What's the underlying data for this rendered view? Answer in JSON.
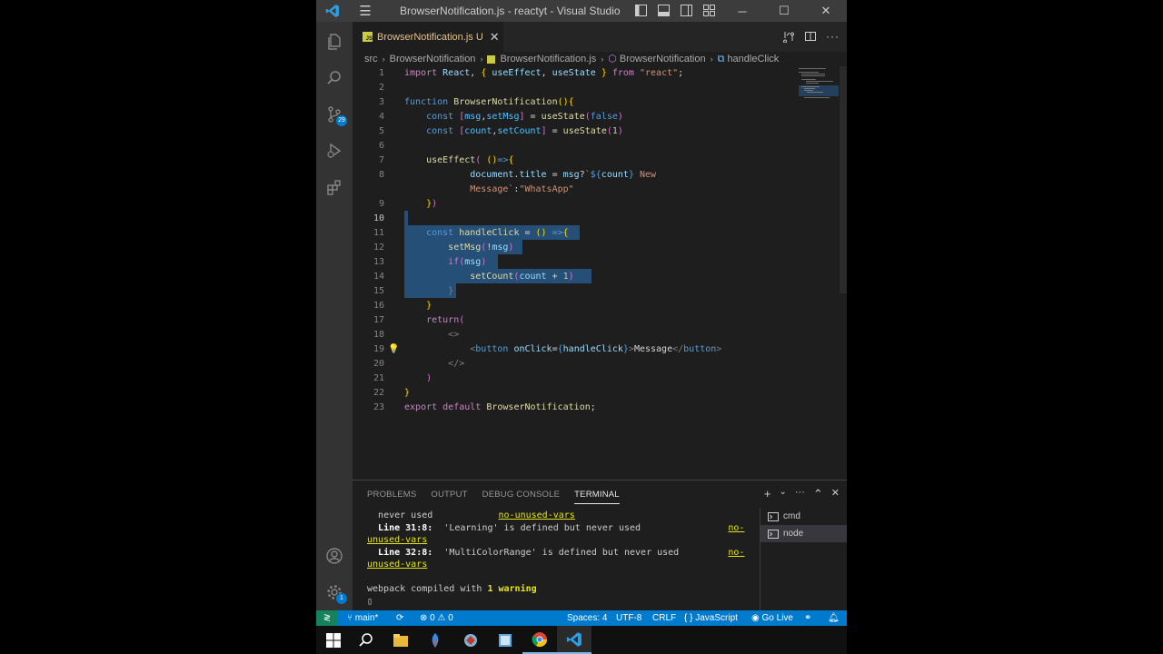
{
  "window": {
    "title": "BrowserNotification.js - reactyt - Visual Studio Code",
    "min_glyph": "─",
    "max_glyph": "☐",
    "close_glyph": "✕",
    "menu_glyph": "☰"
  },
  "activity_bar": {
    "source_control_badge": "29",
    "settings_badge": "1"
  },
  "tab": {
    "file_label": "BrowserNotification.js",
    "status": "U",
    "js_badge": "JS",
    "close_glyph": "✕"
  },
  "breadcrumb": {
    "part1": "src",
    "part2": "BrowserNotification",
    "part3": "BrowserNotification.js",
    "part4": "BrowserNotification",
    "part5": "handleClick",
    "sep": "›"
  },
  "editor": {
    "line_numbers": [
      "1",
      "2",
      "3",
      "4",
      "5",
      "6",
      "7",
      "8",
      "",
      "9",
      "10",
      "11",
      "12",
      "13",
      "14",
      "15",
      "16",
      "17",
      "18",
      "19",
      "20",
      "21",
      "22",
      "23"
    ],
    "lightbulb": "💡"
  },
  "panel": {
    "tabs": {
      "problems": "PROBLEMS",
      "output": "OUTPUT",
      "debug_console": "DEBUG CONSOLE",
      "terminal": "TERMINAL"
    },
    "actions": {
      "add": "+",
      "dropdown": "⌄",
      "more": "···",
      "maximize": "⌃",
      "close": "✕"
    },
    "terminal_lines": {
      "l1_a": "never used",
      "l1_b": "no-unused-vars",
      "l2_a": "Line 31:8:",
      "l2_b": "'Learning' is defined but never used",
      "l2_c": "no-",
      "l3": "unused-vars",
      "l4_a": "Line 32:8:",
      "l4_b": "'MultiColorRange' is defined but never used",
      "l4_c": "no-",
      "l5": "unused-vars",
      "l6_a": "webpack compiled with ",
      "l6_b": "1 warning",
      "l7": "▯"
    },
    "terminal_list": [
      {
        "label": "cmd"
      },
      {
        "label": "node"
      }
    ]
  },
  "statusbar": {
    "remote_glyph": "≷",
    "branch": "main*",
    "sync_glyph": "⟳",
    "errors": "0",
    "warnings": "0",
    "spaces": "Spaces: 4",
    "encoding": "UTF-8",
    "eol": "CRLF",
    "language": "JavaScript",
    "language_glyph": "{ }",
    "golive": "Go Live"
  }
}
